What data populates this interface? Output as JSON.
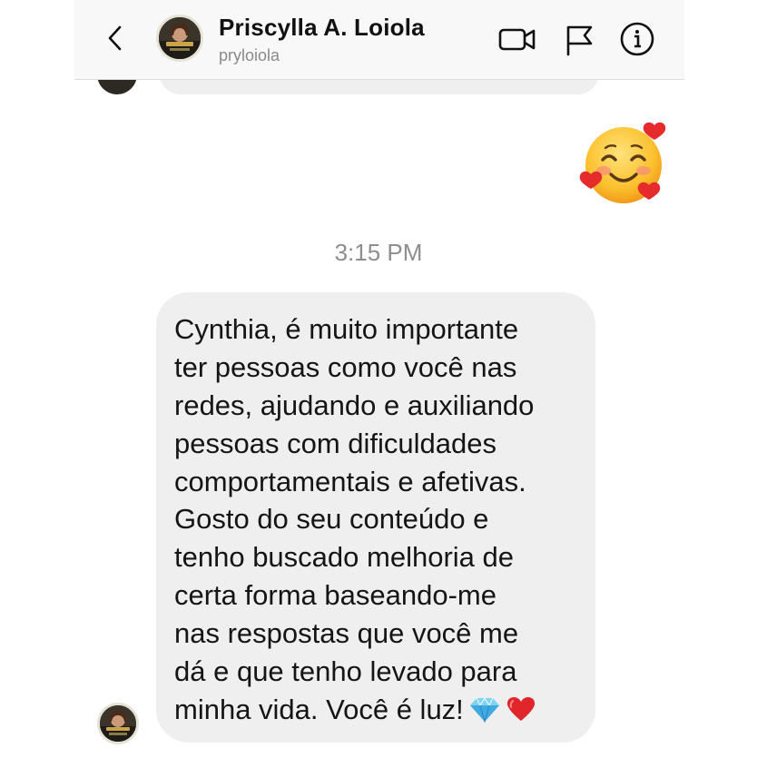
{
  "header": {
    "contact_name": "Priscylla A. Loiola",
    "username": "pryloiola",
    "icons": [
      "chevron-left-icon",
      "video-camera-icon",
      "flag-icon",
      "info-icon"
    ]
  },
  "sent_message": {
    "emoji": "smiling-face-with-hearts"
  },
  "timestamp": "3:15 PM",
  "received_message": {
    "lines": [
      "Cynthia, é muito importante",
      "ter pessoas como você nas",
      "redes, ajudando e auxiliando",
      "pessoas com dificuldades",
      "comportamentais e afetivas.",
      "Gosto do seu conteúdo e",
      "tenho buscado melhoria de",
      "certa forma baseando-me",
      "nas respostas que você me",
      "dá e que tenho levado para",
      "minha vida. Você é luz!"
    ],
    "trailing_emojis": [
      "gem-stone",
      "red-heart"
    ]
  },
  "colors": {
    "header_bg": "#f8f8f8",
    "bubble_bg": "#efefef",
    "timestamp": "#8e8e8e",
    "username": "#8a8a8a"
  }
}
